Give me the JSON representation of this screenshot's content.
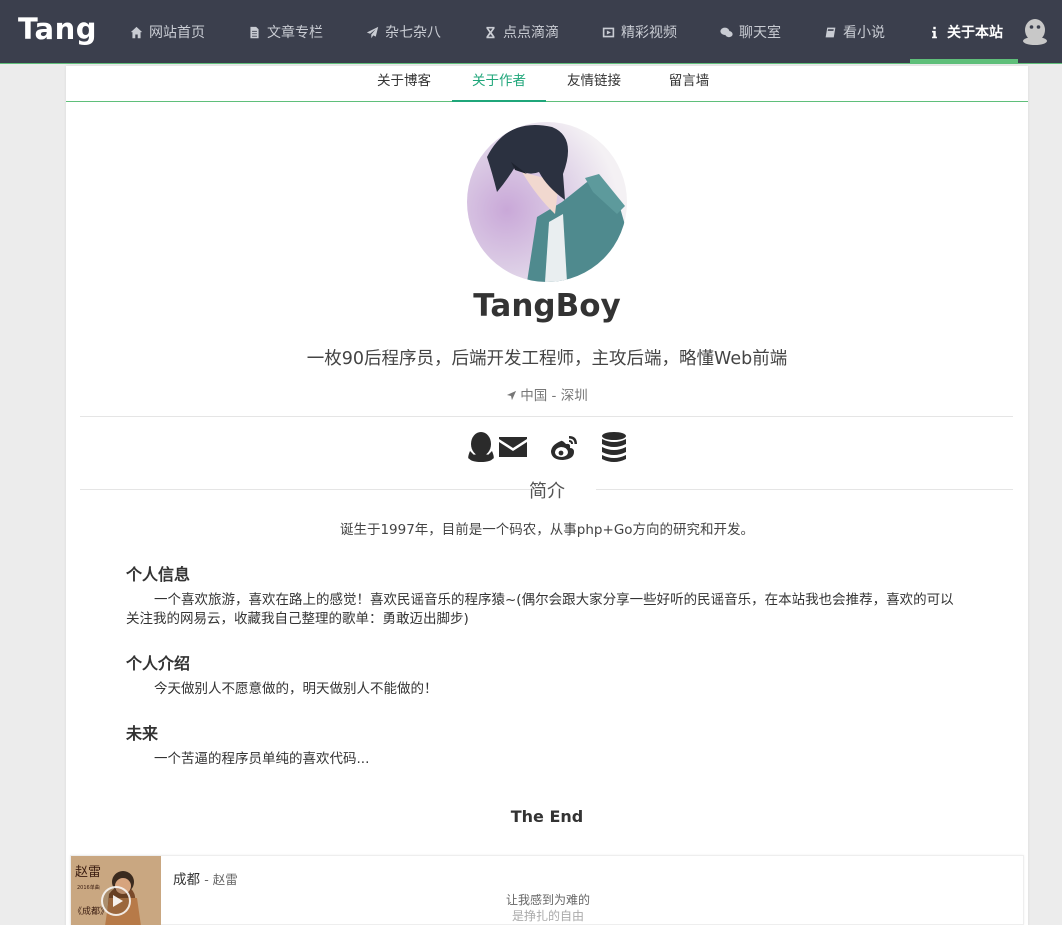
{
  "brand": "Tang",
  "nav": [
    {
      "label": "网站首页",
      "icon": "home-icon"
    },
    {
      "label": "文章专栏",
      "icon": "document-icon"
    },
    {
      "label": "杂七杂八",
      "icon": "paper-plane-icon"
    },
    {
      "label": "点点滴滴",
      "icon": "hourglass-icon"
    },
    {
      "label": "精彩视频",
      "icon": "video-icon"
    },
    {
      "label": "聊天室",
      "icon": "wechat-icon"
    },
    {
      "label": "看小说",
      "icon": "book-icon"
    },
    {
      "label": "关于本站",
      "icon": "info-icon",
      "active": true
    }
  ],
  "subtabs": [
    "关于博客",
    "关于作者",
    "友情链接",
    "留言墙"
  ],
  "active_subtab": "关于作者",
  "profile": {
    "name": "TangBoy",
    "tagline": "一枚90后程序员，后端开发工程师，主攻后端，略懂Web前端",
    "location": "中国 - 深圳"
  },
  "social_icons": [
    "qq-icon",
    "email-icon",
    "weibo-icon",
    "database-icon"
  ],
  "intro": {
    "title": "简介",
    "text": "诞生于1997年，目前是一个码农，从事php+Go方向的研究和开发。"
  },
  "sections": [
    {
      "heading": "个人信息",
      "text": "一个喜欢旅游，喜欢在路上的感觉！喜欢民谣音乐的程序猿~(偶尔会跟大家分享一些好听的民谣音乐，在本站我也会推荐，喜欢的可以关注我的网易云，收藏我自己整理的歌单：勇敢迈出脚步)"
    },
    {
      "heading": "个人介绍",
      "text": "今天做别人不愿意做的，明天做别人不能做的！"
    },
    {
      "heading": "未来",
      "text": "一个苦逼的程序员单纯的喜欢代码..."
    }
  ],
  "the_end": "The End",
  "player": {
    "song": "成都",
    "artist": "- 赵雷",
    "lyric_current": "让我感到为难的",
    "lyric_next": "是挣扎的自由",
    "album_text": [
      "赵雷",
      "2016单曲",
      "《成都》"
    ]
  }
}
